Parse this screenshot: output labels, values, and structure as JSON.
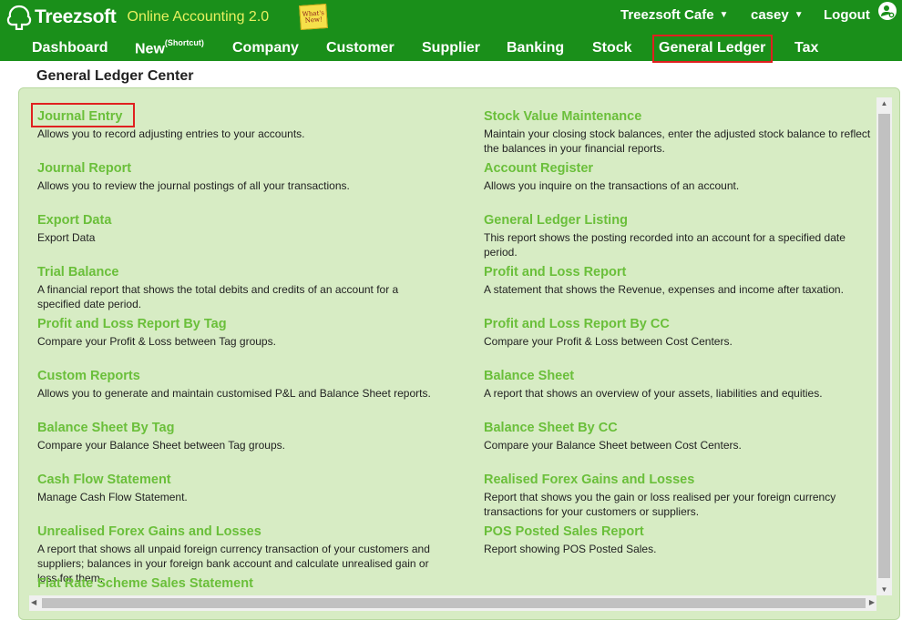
{
  "app": {
    "brand_name": "Treezsoft",
    "brand_sub": "Online Accounting 2.0",
    "whats_new": "What's New!"
  },
  "topbar": {
    "company": "Treezsoft Cafe",
    "user": "casey",
    "logout": "Logout"
  },
  "nav": {
    "items": [
      {
        "label": "Dashboard"
      },
      {
        "label": "New",
        "sup": "(Shortcut)"
      },
      {
        "label": "Company"
      },
      {
        "label": "Customer"
      },
      {
        "label": "Supplier"
      },
      {
        "label": "Banking"
      },
      {
        "label": "Stock"
      },
      {
        "label": "General Ledger"
      },
      {
        "label": "Tax"
      }
    ],
    "active": "General Ledger"
  },
  "page": {
    "title": "General Ledger Center"
  },
  "left_items": [
    {
      "title": "Journal Entry",
      "desc": "Allows you to record adjusting entries to your accounts."
    },
    {
      "title": "Journal Report",
      "desc": "Allows you to review the journal postings of all your transactions."
    },
    {
      "title": "Export Data",
      "desc": "Export Data"
    },
    {
      "title": "Trial Balance",
      "desc": "A financial report that shows the total debits and credits of an account for a specified date period."
    },
    {
      "title": "Profit and Loss Report By Tag",
      "desc": "Compare your Profit & Loss between Tag groups."
    },
    {
      "title": "Custom Reports",
      "desc": "Allows you to generate and maintain customised P&L and Balance Sheet reports."
    },
    {
      "title": "Balance Sheet By Tag",
      "desc": "Compare your Balance Sheet between Tag groups."
    },
    {
      "title": "Cash Flow Statement",
      "desc": "Manage Cash Flow Statement."
    },
    {
      "title": "Unrealised Forex Gains and Losses",
      "desc": "A report that shows all unpaid foreign currency transaction of your customers and suppliers; balances in your foreign bank account and calculate unrealised gain or loss for them."
    },
    {
      "title": "Flat Rate Scheme Sales Statement",
      "desc": ""
    }
  ],
  "right_items": [
    {
      "title": "Stock Value Maintenance",
      "desc": "Maintain your closing stock balances, enter the adjusted stock balance to reflect the balances in your financial reports."
    },
    {
      "title": "Account Register",
      "desc": "Allows you inquire on the transactions of an account."
    },
    {
      "title": "General Ledger Listing",
      "desc": "This report shows the posting recorded into an account for a specified date period."
    },
    {
      "title": "Profit and Loss Report",
      "desc": "A statement that shows the Revenue, expenses and income after taxation."
    },
    {
      "title": "Profit and Loss Report By CC",
      "desc": "Compare your Profit & Loss between Cost Centers."
    },
    {
      "title": "Balance Sheet",
      "desc": "A report that shows an overview of your assets, liabilities and equities."
    },
    {
      "title": "Balance Sheet By CC",
      "desc": "Compare your Balance Sheet between Cost Centers."
    },
    {
      "title": "Realised Forex Gains and Losses",
      "desc": "Report that shows you the gain or loss realised per your foreign currency transactions for your customers or suppliers."
    },
    {
      "title": "POS Posted Sales Report",
      "desc": "Report showing POS Posted Sales."
    }
  ],
  "colors": {
    "header_green": "#1a8f1a",
    "panel_green": "#d7ecc4",
    "link_green": "#6abf3a",
    "highlight_red": "#e02020",
    "sub_yellow": "#e8f060"
  },
  "icons": {
    "brand": "tree-logo-icon",
    "user": "user-gear-icon",
    "caret": "chevron-down-icon"
  }
}
